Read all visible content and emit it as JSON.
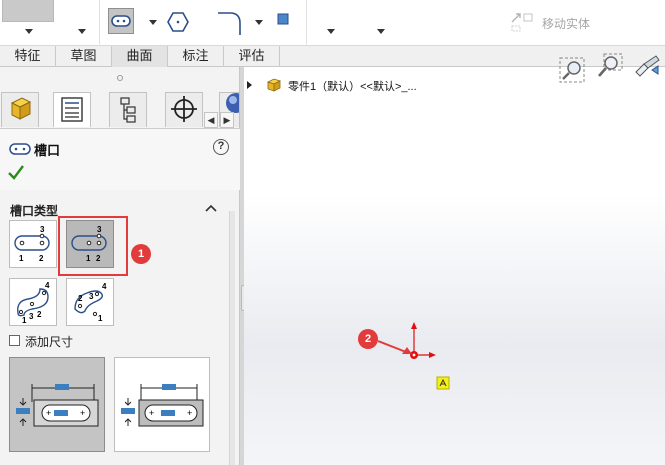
{
  "toolbar": {
    "move_entity_label": "移动实体"
  },
  "tabs": [
    {
      "label": "特征"
    },
    {
      "label": "草图"
    },
    {
      "label": "曲面"
    },
    {
      "label": "标注"
    },
    {
      "label": "评估"
    }
  ],
  "property_manager": {
    "title": "槽口",
    "help_icon": "?",
    "group": {
      "title": "槽口类型",
      "slot_types": [
        {
          "name": "straight-slot",
          "labels": [
            "3",
            "1",
            "2"
          ]
        },
        {
          "name": "centerpoint-straight-slot",
          "labels": [
            "3",
            "1",
            "2"
          ]
        },
        {
          "name": "three-point-arc-slot",
          "labels": [
            "4",
            "1",
            "3",
            "2"
          ]
        },
        {
          "name": "centerpoint-arc-slot",
          "labels": [
            "4",
            "2",
            "3",
            "1"
          ]
        }
      ],
      "add_dimensions_label": "添加尺寸",
      "add_dimensions_checked": false
    }
  },
  "annotations": {
    "badge1": "1",
    "badge2": "2"
  },
  "tree": {
    "root_label": "零件1（默认）<<默认>_..."
  },
  "colors": {
    "highlight": "#e23b3b",
    "ok_check": "#2e8b1e",
    "axis_red": "#e01010"
  }
}
